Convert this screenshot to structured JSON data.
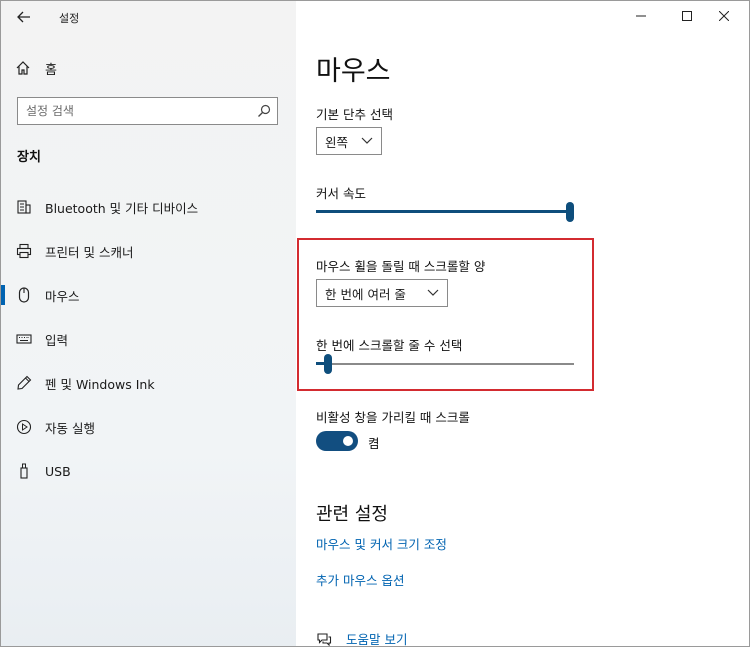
{
  "window": {
    "title": "설정"
  },
  "sidebar": {
    "home_label": "홈",
    "search_placeholder": "설정 검색",
    "section_title": "장치",
    "items": [
      {
        "label": "Bluetooth 및 기타 디바이스",
        "icon": "bluetooth-devices-icon"
      },
      {
        "label": "프린터 및 스캐너",
        "icon": "printer-icon"
      },
      {
        "label": "마우스",
        "icon": "mouse-icon",
        "selected": true
      },
      {
        "label": "입력",
        "icon": "keyboard-icon"
      },
      {
        "label": "펜 및 Windows Ink",
        "icon": "pen-icon"
      },
      {
        "label": "자동 실행",
        "icon": "autoplay-icon"
      },
      {
        "label": "USB",
        "icon": "usb-icon"
      }
    ]
  },
  "main": {
    "title": "마우스",
    "primary_button": {
      "label": "기본 단추 선택",
      "value": "왼쪽"
    },
    "cursor_speed": {
      "label": "커서 속도",
      "value": 1.0
    },
    "scroll_amount": {
      "label": "마우스 휠을 돌릴 때 스크롤할 양",
      "value": "한 번에 여러 줄"
    },
    "lines_to_scroll": {
      "label": "한 번에 스크롤할 줄 수 선택",
      "value": 0.03
    },
    "inactive_scroll": {
      "label": "비활성 창을 가리킬 때 스크롤",
      "state": "켬"
    },
    "related": {
      "title": "관련 설정",
      "links": [
        "마우스 및 커서 크기 조정",
        "추가 마우스 옵션"
      ]
    },
    "help_label": "도움말 보기"
  },
  "colors": {
    "accent": "#0063b1",
    "slider": "#0e4e7c",
    "highlight_border": "#d32b30"
  }
}
